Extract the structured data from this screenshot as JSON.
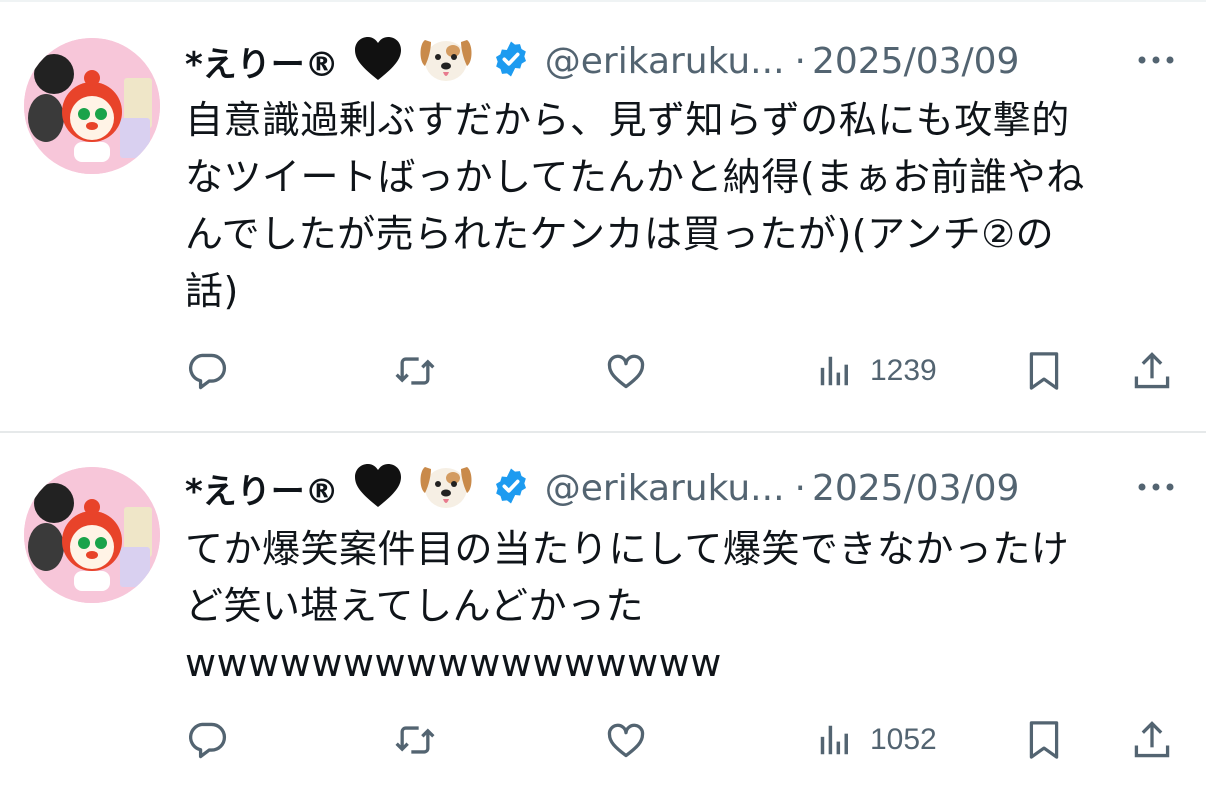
{
  "tweets": [
    {
      "display_name": "*えりー®",
      "handle": "@erikaruku...",
      "separator": "·",
      "date": "2025/03/09",
      "text": "自意識過剰ぶすだから、見ず知らずの私にも攻撃的\nなツイートばっかしてたんかと納得(まぁお前誰やね\nんでしたが売られたケンカは買ったが)(アンチ②の\n話)",
      "views": "1239"
    },
    {
      "display_name": "*えりー®",
      "handle": "@erikaruku...",
      "separator": "·",
      "date": "2025/03/09",
      "text": "てか爆笑案件目の当たりにして爆笑できなかったけ\nど笑い堪えてしんどかった\nwwwwwwwwwwwwwwwww",
      "views": "1052"
    }
  ],
  "icons": {
    "name_emojis": [
      "black-heart-icon",
      "dog-face-icon"
    ],
    "verified": "verified-badge-icon",
    "more": "more-dots-icon",
    "actions": [
      "reply-icon",
      "retweet-icon",
      "like-icon",
      "views-icon",
      "bookmark-icon",
      "share-icon"
    ]
  },
  "colors": {
    "text": "#0f1419",
    "secondary": "#536471",
    "verified_blue": "#1d9bf0",
    "divider": "#e6e9ea",
    "avatar_bg": "#f7c6d9"
  }
}
